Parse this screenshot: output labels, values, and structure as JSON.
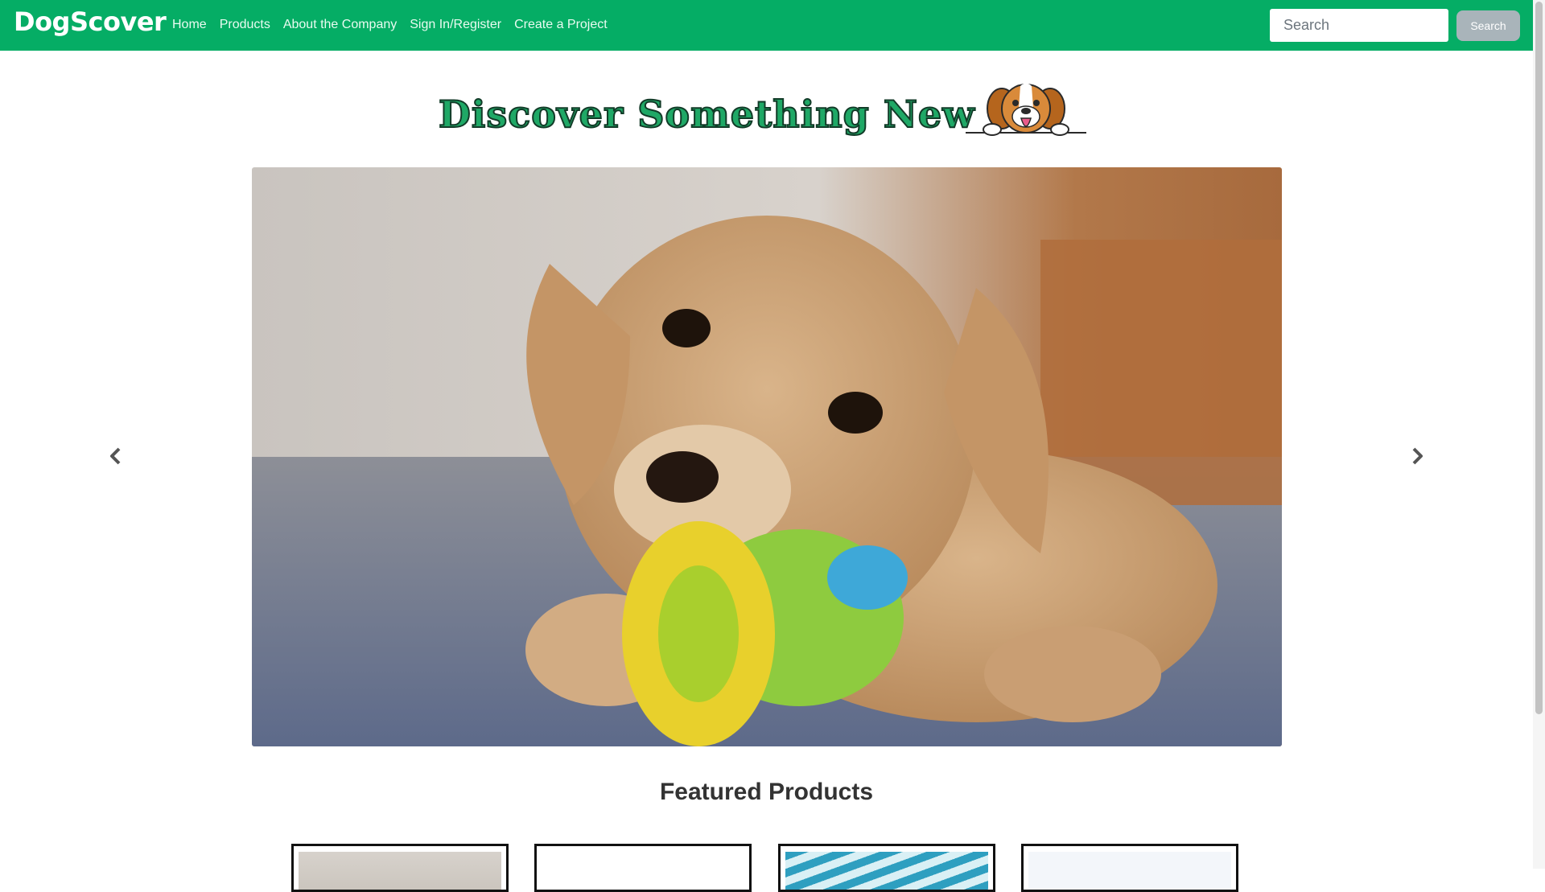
{
  "navbar": {
    "brand": "DogScover",
    "links": [
      "Home",
      "Products",
      "About the Company",
      "Sign In/Register",
      "Create a Project"
    ],
    "search_placeholder": "Search",
    "search_button": "Search"
  },
  "hero": {
    "heading": "Discover Something New",
    "mascot_icon": "beagle-peeking-icon"
  },
  "carousel": {
    "image_subject": "puppy-chewing-toy-photo",
    "prev_icon": "chevron-left-icon",
    "next_icon": "chevron-right-icon"
  },
  "featured": {
    "title": "Featured Products",
    "card_count": 4
  },
  "colors": {
    "brand_green": "#05ad65",
    "heading_green": "#1fa866",
    "button_gray": "#a9b4ba"
  }
}
